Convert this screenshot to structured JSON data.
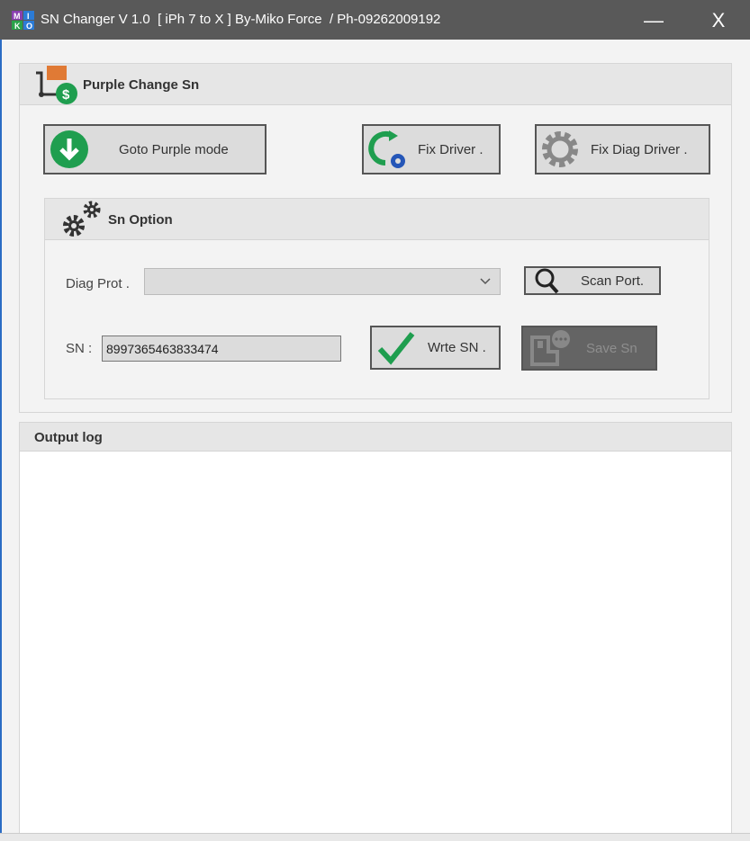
{
  "window": {
    "title": "SN Changer V 1.0  [ iPh 7 to X ] By-Miko Force  / Ph-09262009192",
    "logo_text": "MIKO",
    "minimize": "—",
    "close": "X"
  },
  "main_panel": {
    "title": "Purple  Change Sn",
    "buttons": {
      "goto_purple": "Goto Purple mode",
      "fix_driver": "Fix Driver .",
      "fix_diag_driver": "Fix Diag Driver ."
    }
  },
  "sn_option": {
    "title": "Sn Option",
    "diag_port_label": "Diag Prot .",
    "diag_port_value": "",
    "scan_port": "Scan Port.",
    "sn_label": "SN :",
    "sn_value": "8997365463833474",
    "write_sn": "Wrte SN .",
    "save_sn": "Save Sn"
  },
  "output_log": {
    "title": "Output log",
    "content": ""
  },
  "colors": {
    "titlebar": "#595959",
    "green": "#1f9e4f",
    "orange": "#e07a35",
    "save_disabled": "#646464"
  }
}
